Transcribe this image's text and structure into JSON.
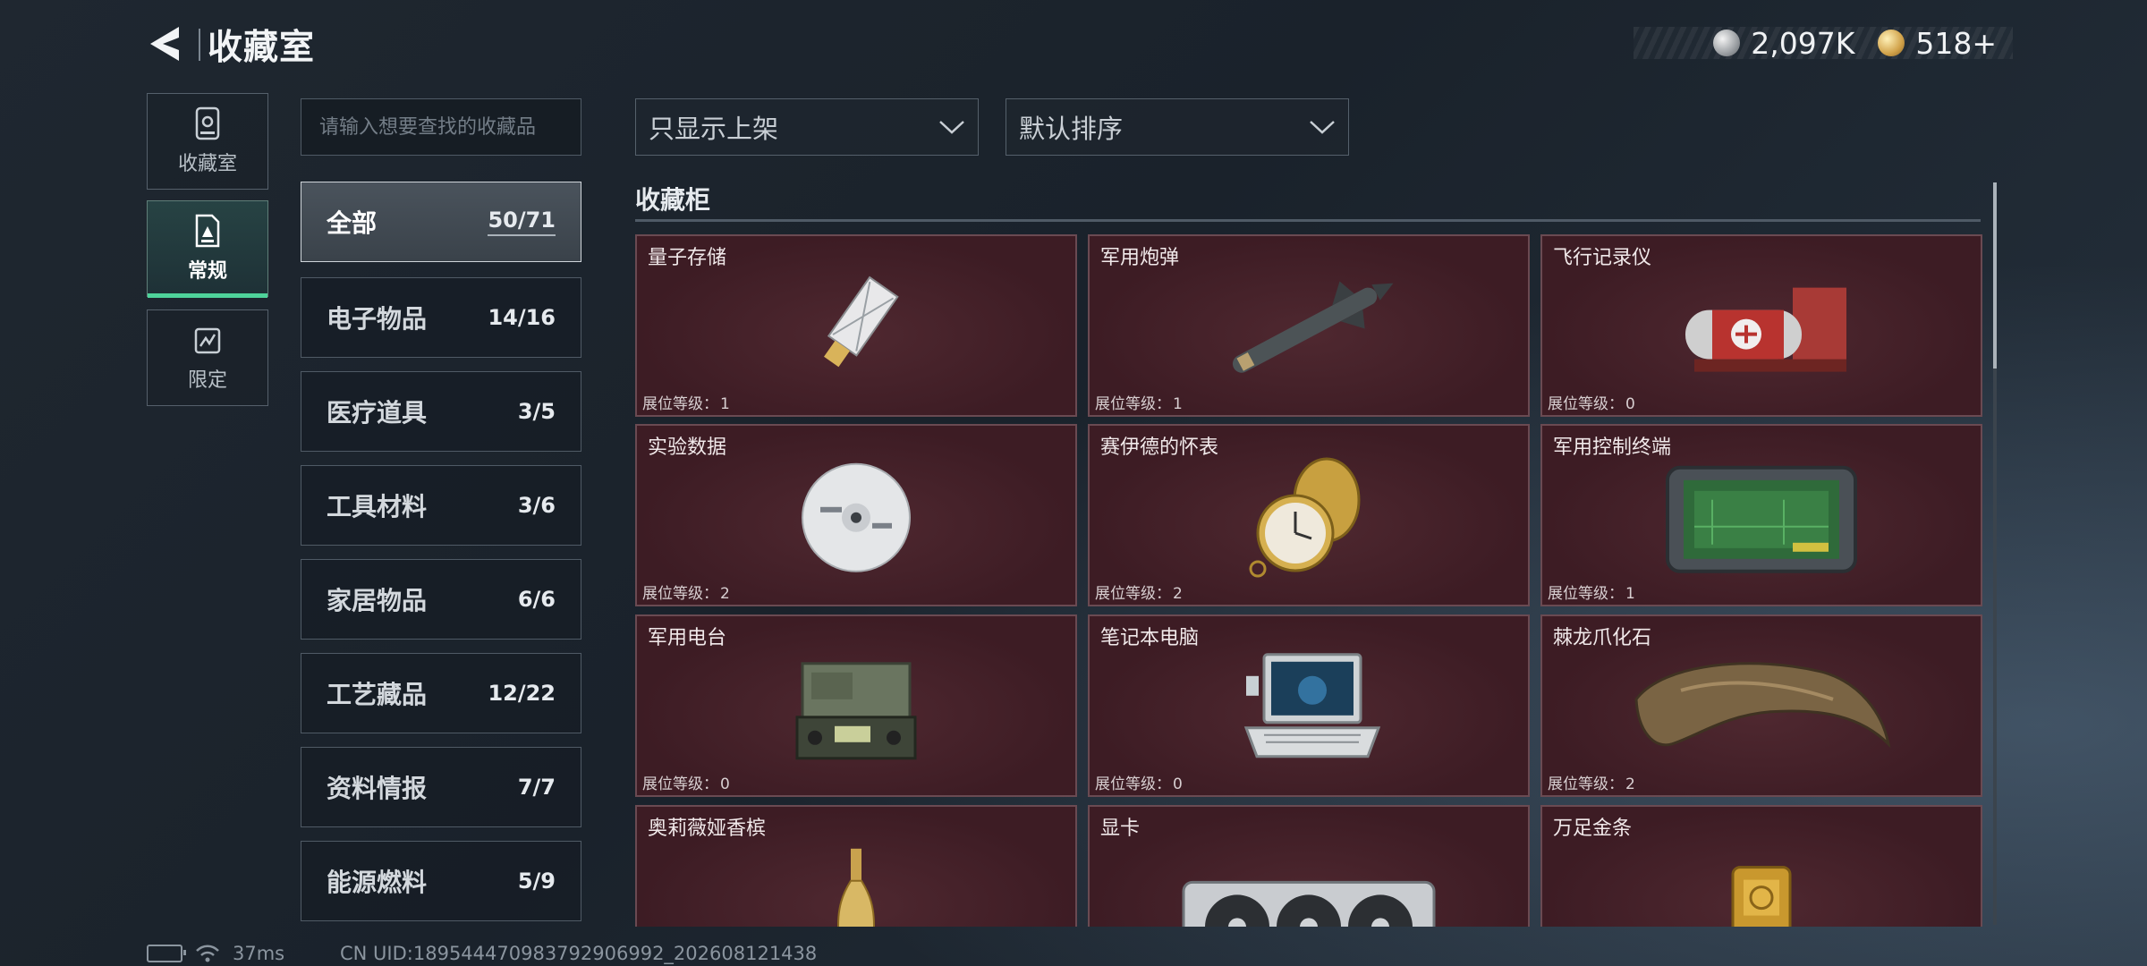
{
  "header": {
    "title": "收藏室"
  },
  "currency": [
    {
      "icon": "silver-coin-icon",
      "value": "2,097K"
    },
    {
      "icon": "gold-coin-icon",
      "value": "518+"
    }
  ],
  "nav": [
    {
      "label": "收藏室",
      "icon": "collection-room-icon",
      "active": false
    },
    {
      "label": "常规",
      "icon": "regular-icon",
      "active": true
    },
    {
      "label": "限定",
      "icon": "limited-icon",
      "active": false
    }
  ],
  "search": {
    "placeholder": "请输入想要查找的收藏品"
  },
  "categories": [
    {
      "name": "全部",
      "count": "50/71",
      "active": true
    },
    {
      "name": "电子物品",
      "count": "14/16"
    },
    {
      "name": "医疗道具",
      "count": "3/5"
    },
    {
      "name": "工具材料",
      "count": "3/6"
    },
    {
      "name": "家居物品",
      "count": "6/6"
    },
    {
      "name": "工艺藏品",
      "count": "12/22"
    },
    {
      "name": "资料情报",
      "count": "7/7"
    },
    {
      "name": "能源燃料",
      "count": "5/9"
    }
  ],
  "filters": {
    "filter_value": "只显示上架",
    "sort_value": "默认排序"
  },
  "section": {
    "title": "收藏柜"
  },
  "level_label": "展位等级：",
  "items": [
    {
      "name": "量子存储",
      "level": "1",
      "icon": "usb-drive-icon"
    },
    {
      "name": "军用炮弹",
      "level": "1",
      "icon": "missile-icon"
    },
    {
      "name": "飞行记录仪",
      "level": "0",
      "icon": "flight-recorder-icon"
    },
    {
      "name": "实验数据",
      "level": "2",
      "icon": "disc-icon"
    },
    {
      "name": "赛伊德的怀表",
      "level": "2",
      "icon": "pocket-watch-icon"
    },
    {
      "name": "军用控制终端",
      "level": "1",
      "icon": "control-terminal-icon"
    },
    {
      "name": "军用电台",
      "level": "0",
      "icon": "radio-icon"
    },
    {
      "name": "笔记本电脑",
      "level": "0",
      "icon": "laptop-icon"
    },
    {
      "name": "棘龙爪化石",
      "level": "2",
      "icon": "claw-fossil-icon"
    },
    {
      "name": "奥莉薇娅香槟",
      "level": "",
      "icon": "champagne-icon"
    },
    {
      "name": "显卡",
      "level": "",
      "icon": "gpu-icon"
    },
    {
      "name": "万足金条",
      "level": "",
      "icon": "gold-bar-icon"
    }
  ],
  "status": {
    "ping": "37ms",
    "uid": "CN UID:18954447098379290699​2_202608121438"
  }
}
